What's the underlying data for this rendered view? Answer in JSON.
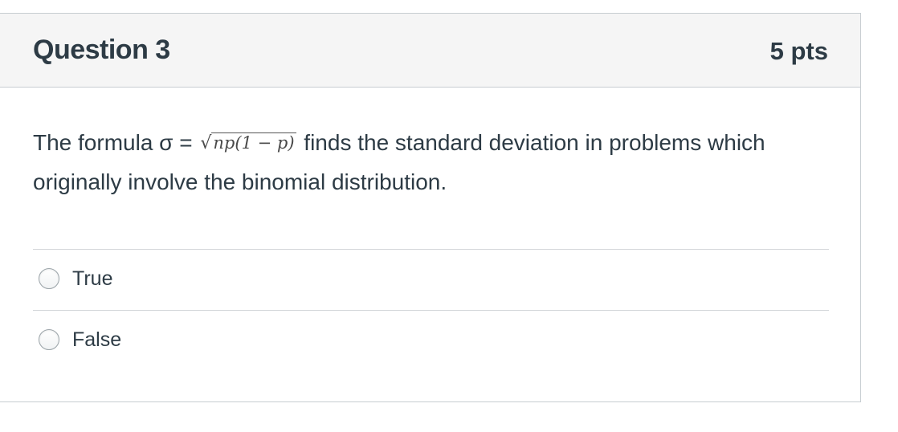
{
  "question": {
    "title": "Question 3",
    "points": "5 pts",
    "text_before": "The formula σ = ",
    "formula_radical": "√",
    "formula_radicand": "np(1 − p)",
    "text_after": " finds the standard deviation in problems which originally involve the binomial distribution."
  },
  "answers": [
    {
      "label": "True",
      "selected": false
    },
    {
      "label": "False",
      "selected": false
    }
  ]
}
